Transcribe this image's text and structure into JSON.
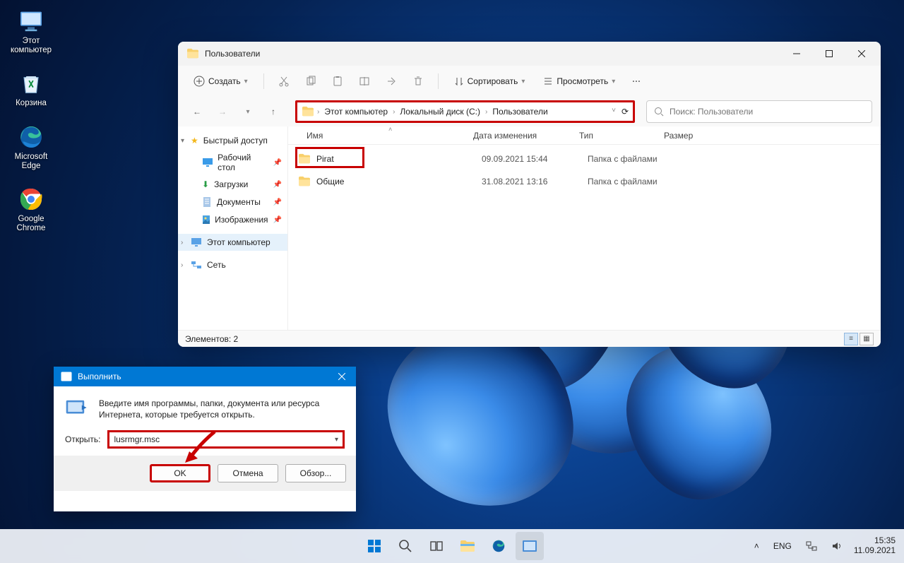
{
  "desktop_icons": [
    {
      "label": "Этот\nкомпьютер",
      "name": "this-pc-icon"
    },
    {
      "label": "Корзина",
      "name": "recycle-bin-icon"
    },
    {
      "label": "Microsoft\nEdge",
      "name": "edge-icon"
    },
    {
      "label": "Google\nChrome",
      "name": "chrome-icon"
    }
  ],
  "explorer": {
    "title": "Пользователи",
    "toolbar": {
      "new": "Создать",
      "sort": "Сортировать",
      "view": "Просмотреть"
    },
    "breadcrumb": [
      "Этот компьютер",
      "Локальный диск (C:)",
      "Пользователи"
    ],
    "search_placeholder": "Поиск: Пользователи",
    "nav": {
      "quick": "Быстрый доступ",
      "desktop": "Рабочий стол",
      "downloads": "Загрузки",
      "documents": "Документы",
      "pictures": "Изображения",
      "this_pc": "Этот компьютер",
      "network": "Сеть"
    },
    "columns": {
      "name": "Имя",
      "date": "Дата изменения",
      "type": "Тип",
      "size": "Размер"
    },
    "rows": [
      {
        "name": "Pirat",
        "date": "09.09.2021 15:44",
        "type": "Папка с файлами"
      },
      {
        "name": "Общие",
        "date": "31.08.2021 13:16",
        "type": "Папка с файлами"
      }
    ],
    "status": "Элементов: 2"
  },
  "run": {
    "title": "Выполнить",
    "text": "Введите имя программы, папки, документа или ресурса Интернета, которые требуется открыть.",
    "open_label": "Открыть:",
    "value": "lusrmgr.msc",
    "ok": "OK",
    "cancel": "Отмена",
    "browse": "Обзор..."
  },
  "taskbar": {
    "lang": "ENG",
    "time": "15:35",
    "date": "11.09.2021"
  }
}
